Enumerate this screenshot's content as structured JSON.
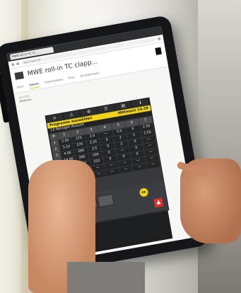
{
  "browser": {
    "tab_title": "MWE roll-in TC cl...",
    "url": "app.mwe.de"
  },
  "app": {
    "title": "MWE roll-in TC clapp...",
    "tabs": [
      "Start",
      "Details",
      "Arbeitsplätze",
      "Flow",
      "Einstellungen"
    ],
    "active_tab": "Details",
    "content_label": "Ansicht",
    "content_value": "Advance"
  },
  "panel": {
    "header_left": "Programm auswählen",
    "header_right": "Mittwoch 14:28",
    "sub_header": "13 Reiniger Ansicht",
    "columns": [
      "#",
      "1",
      "2",
      "3",
      "4",
      "5",
      "6",
      "7"
    ],
    "rows": [
      [
        "1",
        "2.50",
        "270",
        "2.0",
        "—",
        "0.5",
        "0",
        "2.30"
      ],
      [
        "2",
        "3.10",
        "270",
        "2.25",
        "0",
        "2",
        "2",
        "2.50"
      ],
      [
        "3",
        "4.00",
        "280",
        "2.5",
        "0",
        "2",
        "0",
        "—"
      ],
      [
        "4",
        "14.00",
        "290",
        "200",
        "0",
        "—",
        "0",
        "—"
      ],
      [
        "5",
        "13.50",
        "300",
        "210",
        "0",
        "0",
        "0",
        "—"
      ],
      [
        "6",
        "—",
        "—",
        "—",
        "—",
        "—",
        "—",
        "—"
      ],
      [
        "7",
        "—",
        "—",
        "—",
        "—",
        "—",
        "—",
        "—"
      ]
    ],
    "ok_label": "OK"
  },
  "colors": {
    "panel_accent": "#f2d318",
    "warning": "#d9302c"
  }
}
